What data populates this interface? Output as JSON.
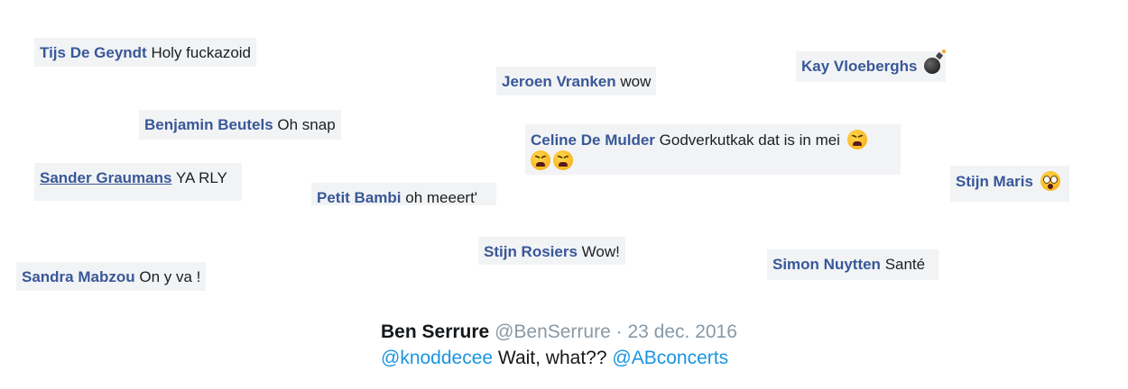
{
  "comments": [
    {
      "author": "Tijs De Geyndt",
      "text": "Holy fuckazoid"
    },
    {
      "author": "Jeroen Vranken",
      "text": "wow"
    },
    {
      "author": "Kay Vloeberghs",
      "text": "",
      "emoji": "bomb-icon"
    },
    {
      "author": "Benjamin Beutels",
      "text": "Oh snap"
    },
    {
      "author": "Celine De Mulder",
      "text": "Godverkutkak dat is in mei",
      "emoji": "tired-face-icon"
    },
    {
      "author": "Sander Graumans",
      "text": "YA RLY"
    },
    {
      "author": "Petit Bambi",
      "text": "oh meeert'"
    },
    {
      "author": "Stijn Maris",
      "text": "",
      "emoji": "astonished-face-icon"
    },
    {
      "author": "Stijn Rosiers",
      "text": "Wow!"
    },
    {
      "author": "Sandra Mabzou",
      "text": "On y va !"
    },
    {
      "author": "Simon Nuytten",
      "text": "Santé"
    }
  ],
  "tweet": {
    "author": "Ben Serrure",
    "handle": "@BenSerrure",
    "separator": "·",
    "date": "23 dec. 2016",
    "mention1": "@knoddecee",
    "text": "Wait, what??",
    "mention2": "@ABconcerts"
  },
  "colors": {
    "bubble_bg": "#f2f3f5",
    "name": "#385898",
    "mention": "#1b95e0",
    "meta": "#8899a6"
  }
}
